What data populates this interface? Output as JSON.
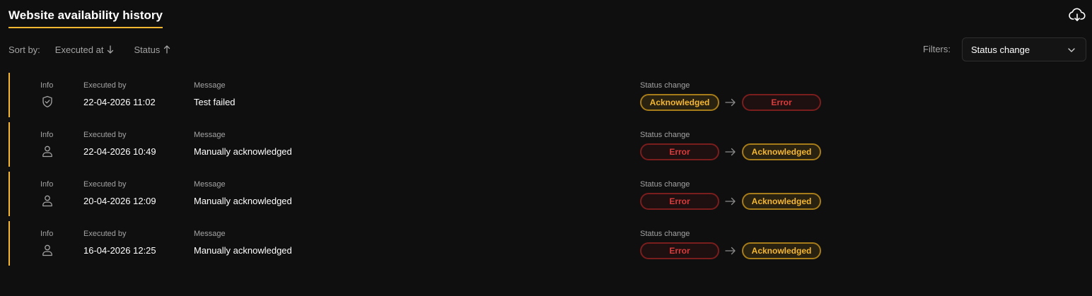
{
  "header": {
    "title": "Website availability history",
    "download_icon": "cloud-download-icon"
  },
  "sort": {
    "label": "Sort by:",
    "options": [
      {
        "label": "Executed at",
        "direction": "down"
      },
      {
        "label": "Status",
        "direction": "up"
      }
    ]
  },
  "filters": {
    "label": "Filters:",
    "selected": "Status change"
  },
  "colors": {
    "accent": "#f5b731",
    "error": "#dc3b3b",
    "background": "#0f0f0f"
  },
  "columns": {
    "info": "Info",
    "executed_by": "Executed by",
    "message": "Message",
    "status_change": "Status change"
  },
  "rows": [
    {
      "icon": "shield-check-icon",
      "executed": "22-04-2026 11:02",
      "message": "Test failed",
      "from": "Acknowledged",
      "to": "Error"
    },
    {
      "icon": "user-icon",
      "executed": "22-04-2026 10:49",
      "message": "Manually acknowledged",
      "from": "Error",
      "to": "Acknowledged"
    },
    {
      "icon": "user-icon",
      "executed": "20-04-2026 12:09",
      "message": "Manually acknowledged",
      "from": "Error",
      "to": "Acknowledged"
    },
    {
      "icon": "user-icon",
      "executed": "16-04-2026 12:25",
      "message": "Manually acknowledged",
      "from": "Error",
      "to": "Acknowledged"
    }
  ]
}
